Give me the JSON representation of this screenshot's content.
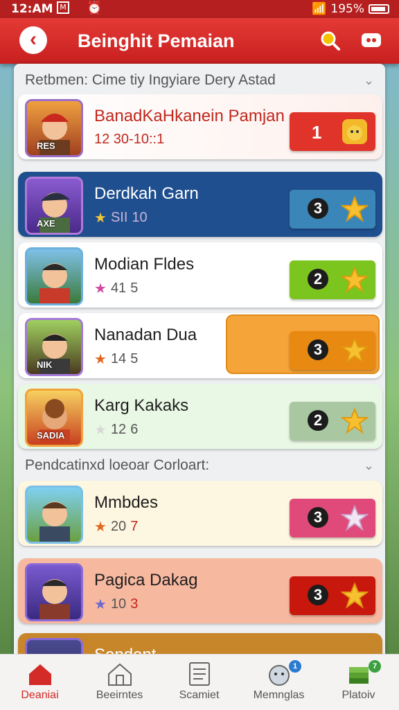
{
  "status_bar": {
    "time": "12:AM",
    "battery": "195%"
  },
  "header": {
    "title": "Beinghit Pemaian"
  },
  "sections": [
    {
      "title": "Retbmen: Cime tiy  Ingyiare Dery Astad"
    },
    {
      "title": "Pendcatinxd loeoar Corloart:"
    }
  ],
  "rows": [
    {
      "name": "BanadKaHkanein Pamjan",
      "stat_a": "12 30-10::1",
      "stat_b": "",
      "button_number": "1",
      "avatar_badge": "RES"
    },
    {
      "name": "Derdkah Garn",
      "stat_a": "SII",
      "stat_b": "10",
      "button_number": "3",
      "avatar_badge": "AXE"
    },
    {
      "name": "Modian Fldes",
      "stat_a": "41",
      "stat_b": "5",
      "button_number": "2",
      "avatar_badge": ""
    },
    {
      "name": "Nanadan Dua",
      "stat_a": "14",
      "stat_b": "5",
      "button_number": "3",
      "avatar_badge": "NIK"
    },
    {
      "name": "Karg Kakaks",
      "stat_a": "12",
      "stat_b": "6",
      "button_number": "2",
      "avatar_badge": "SADIA"
    },
    {
      "name": "Mmbdes",
      "stat_a": "20",
      "stat_b": "7",
      "button_number": "3",
      "avatar_badge": ""
    },
    {
      "name": "Pagica Dakag",
      "stat_a": "10",
      "stat_b": "3",
      "button_number": "3",
      "avatar_badge": ""
    },
    {
      "name": "Sendent",
      "stat_a": "",
      "stat_b": "",
      "button_number": "",
      "avatar_badge": ""
    }
  ],
  "nav": [
    {
      "label": "Deaniai",
      "active": true
    },
    {
      "label": "Beeirntes"
    },
    {
      "label": "Scamiet"
    },
    {
      "label": "Memnglas",
      "badge": "1"
    },
    {
      "label": "Platoiv",
      "badge": "7"
    }
  ],
  "colors": {
    "brand": "#d32b27",
    "active_nav": "#d32b27"
  }
}
